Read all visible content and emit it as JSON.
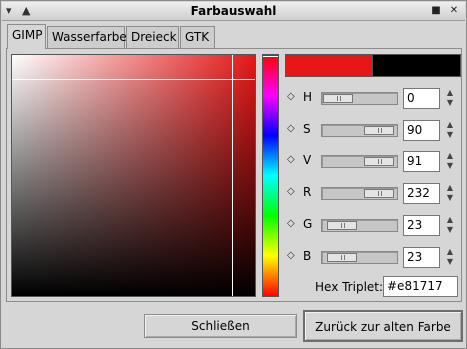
{
  "window": {
    "title": "Farbauswahl"
  },
  "tabs": [
    {
      "label": "GIMP",
      "active": true
    },
    {
      "label": "Wasserfarbe",
      "active": false
    },
    {
      "label": "Dreieck",
      "active": false
    },
    {
      "label": "GTK",
      "active": false
    }
  ],
  "colors": {
    "new": "#e81717",
    "old": "#000000"
  },
  "channels": [
    {
      "label": "H",
      "value": "0",
      "fraction": 0.0
    },
    {
      "label": "S",
      "value": "90",
      "fraction": 0.9
    },
    {
      "label": "V",
      "value": "91",
      "fraction": 0.91
    },
    {
      "label": "R",
      "value": "232",
      "fraction": 0.91
    },
    {
      "label": "G",
      "value": "23",
      "fraction": 0.09
    },
    {
      "label": "B",
      "value": "23",
      "fraction": 0.09
    }
  ],
  "hex": {
    "label": "Hex Triplet:",
    "value": "#e81717"
  },
  "buttons": {
    "close": "Schließen",
    "revert": "Zurück zur alten Farbe"
  },
  "icons": {
    "window_menu": "menu-icon",
    "pin": "pin-icon",
    "minimize": "minimize-icon",
    "close": "close-icon"
  }
}
